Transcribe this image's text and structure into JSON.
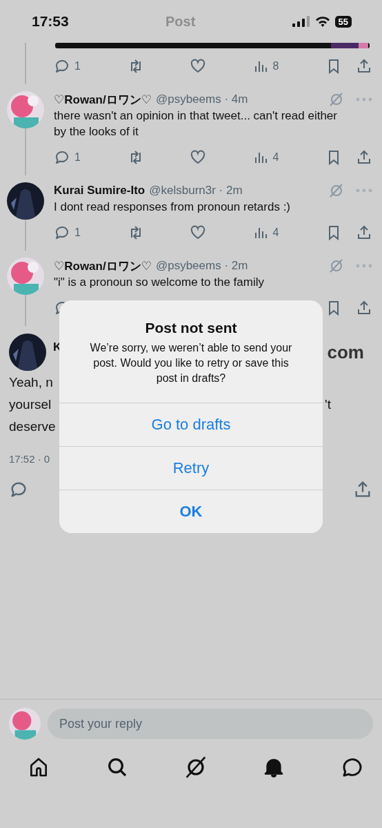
{
  "status_bar": {
    "time": "17:53",
    "battery": "55"
  },
  "header": {
    "title": "Post"
  },
  "previous_post": {
    "actions": {
      "replies": "1",
      "views": "8"
    }
  },
  "replies": [
    {
      "name": "♡Rowan/ロワン♡",
      "meta": "@psybeems · 4m",
      "text": "there wasn't an opinion in that tweet... can't read either by the looks of it",
      "actions": {
        "replies": "1",
        "views": "4"
      }
    },
    {
      "name": "Kurai Sumire-Ito",
      "meta": "@kelsburn3r · 2m",
      "text": "I dont read responses from pronoun retards :)",
      "actions": {
        "replies": "1",
        "views": "4"
      }
    },
    {
      "name": "♡Rowan/ロワン♡",
      "meta": "@psybeems · 2m",
      "text": "\"i\" is a pronoun so welcome to the family"
    }
  ],
  "main_post": {
    "name": "K",
    "name_tail": "com",
    "lines": [
      {
        "left": "Yeah, n"
      },
      {
        "left": "yoursel",
        "right": "'t"
      },
      {
        "left": "deserve"
      }
    ],
    "timestamp": "17:52 · 0"
  },
  "dialog": {
    "title": "Post not sent",
    "message": "We’re sorry, we weren’t able to send your post. Would you like to retry or save this post in drafts?",
    "buttons": [
      {
        "label": "Go to drafts",
        "kind": "normal"
      },
      {
        "label": "Retry",
        "kind": "normal"
      },
      {
        "label": "OK",
        "kind": "bold"
      }
    ]
  },
  "reply_bar": {
    "placeholder": "Post your reply"
  },
  "tab_bar": [
    {
      "selected": false
    },
    {
      "selected": false
    },
    {
      "selected": false
    },
    {
      "selected": true
    },
    {
      "selected": false
    }
  ]
}
